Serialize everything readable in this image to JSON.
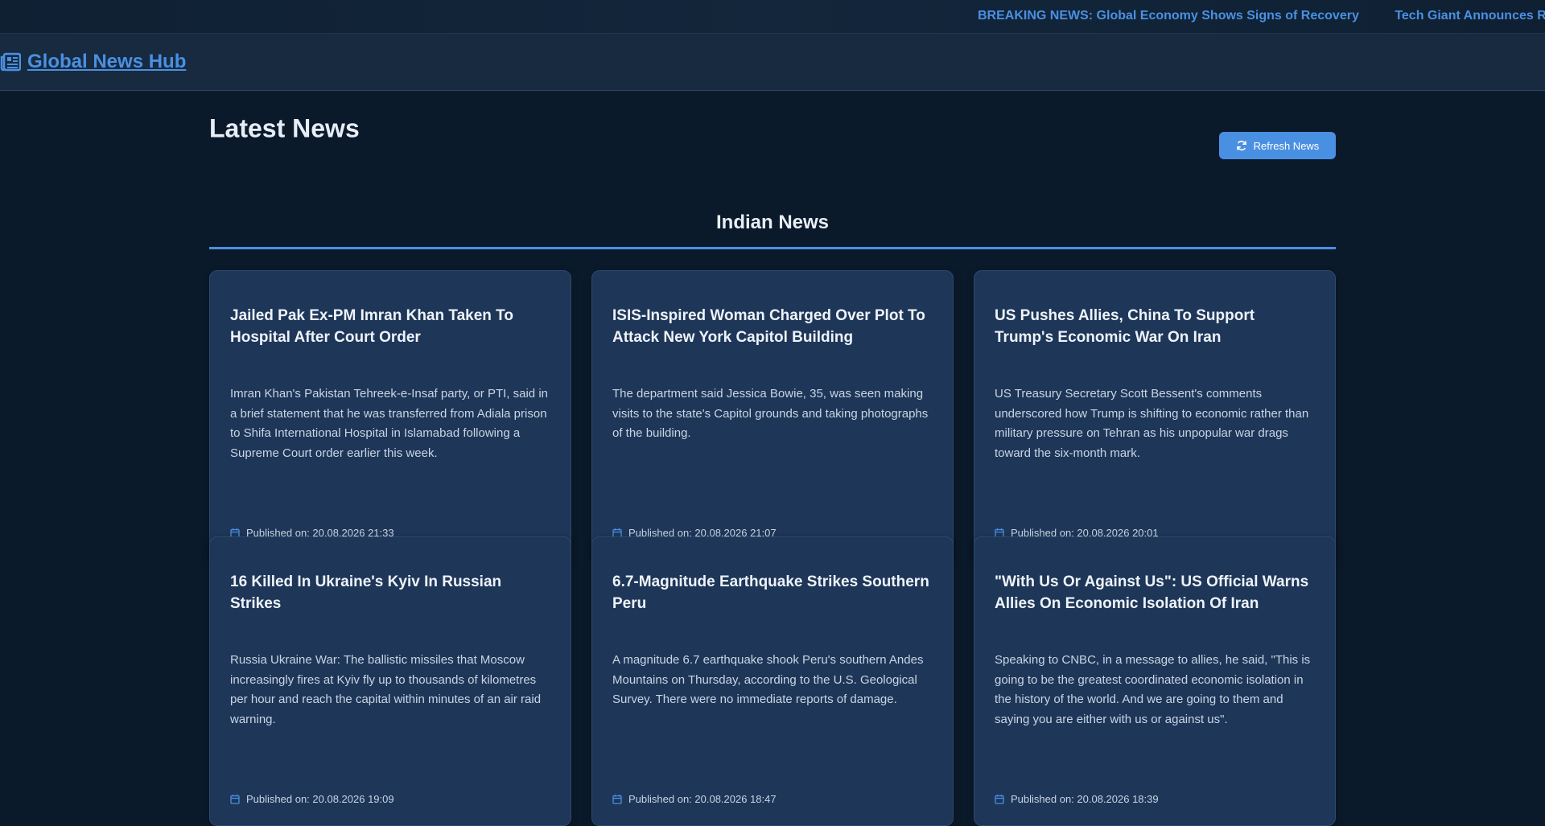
{
  "ticker": {
    "items": [
      "BREAKING NEWS: Global Economy Shows Signs of Recovery",
      "Tech Giant Announces Re"
    ]
  },
  "header": {
    "brand": "Global News Hub",
    "brand_icon": "newspaper-icon"
  },
  "main": {
    "title": "Latest News",
    "refresh_label": "Refresh News",
    "refresh_icon": "refresh-icon",
    "section_title": "Indian News"
  },
  "articles": [
    {
      "title": "Jailed Pak Ex-PM Imran Khan Taken To Hospital After Court Order",
      "description": "Imran Khan's Pakistan Tehreek-e-Insaf party, or PTI, said in a brief statement that he was transferred from Adiala prison to Shifa International Hospital in Islamabad following a Supreme Court order earlier this week.",
      "published": "Published on: 20.08.2026 21:33"
    },
    {
      "title": "ISIS-Inspired Woman Charged Over Plot To Attack New York Capitol Building",
      "description": "The department said Jessica Bowie, 35, was seen making visits to the state's Capitol grounds and taking photographs of the building.",
      "published": "Published on: 20.08.2026 21:07"
    },
    {
      "title": "US Pushes Allies, China To Support Trump's Economic War On Iran",
      "description": "US Treasury Secretary Scott Bessent's comments underscored how Trump is shifting to economic rather than military pressure on Tehran as his unpopular war drags toward the six-month mark.",
      "published": "Published on: 20.08.2026 20:01"
    },
    {
      "title": "16 Killed In Ukraine's Kyiv In Russian Strikes",
      "description": "Russia Ukraine War: The ballistic missiles that Moscow increasingly fires at Kyiv fly up to thousands of kilometres per hour and reach the capital within minutes of an air raid warning.",
      "published": "Published on: 20.08.2026 19:09"
    },
    {
      "title": "6.7-Magnitude Earthquake Strikes Southern Peru",
      "description": "A magnitude 6.7 earthquake shook Peru's southern Andes Mountains on Thursday, according to the U.S. Geological Survey. There were no immediate reports of damage.",
      "published": "Published on: 20.08.2026 18:47"
    },
    {
      "title": "\"With Us Or Against Us\": US Official Warns Allies On Economic Isolation Of Iran",
      "description": "Speaking to CNBC, in a message to allies, he said, \"This is going to be the greatest coordinated economic isolation in the history of the world. And we are going to them and saying you are either with us or against us\".",
      "published": "Published on: 20.08.2026 18:39"
    }
  ],
  "colors": {
    "accent": "#4a90e2",
    "background": "#0b1a2b",
    "card": "#1e3658"
  }
}
